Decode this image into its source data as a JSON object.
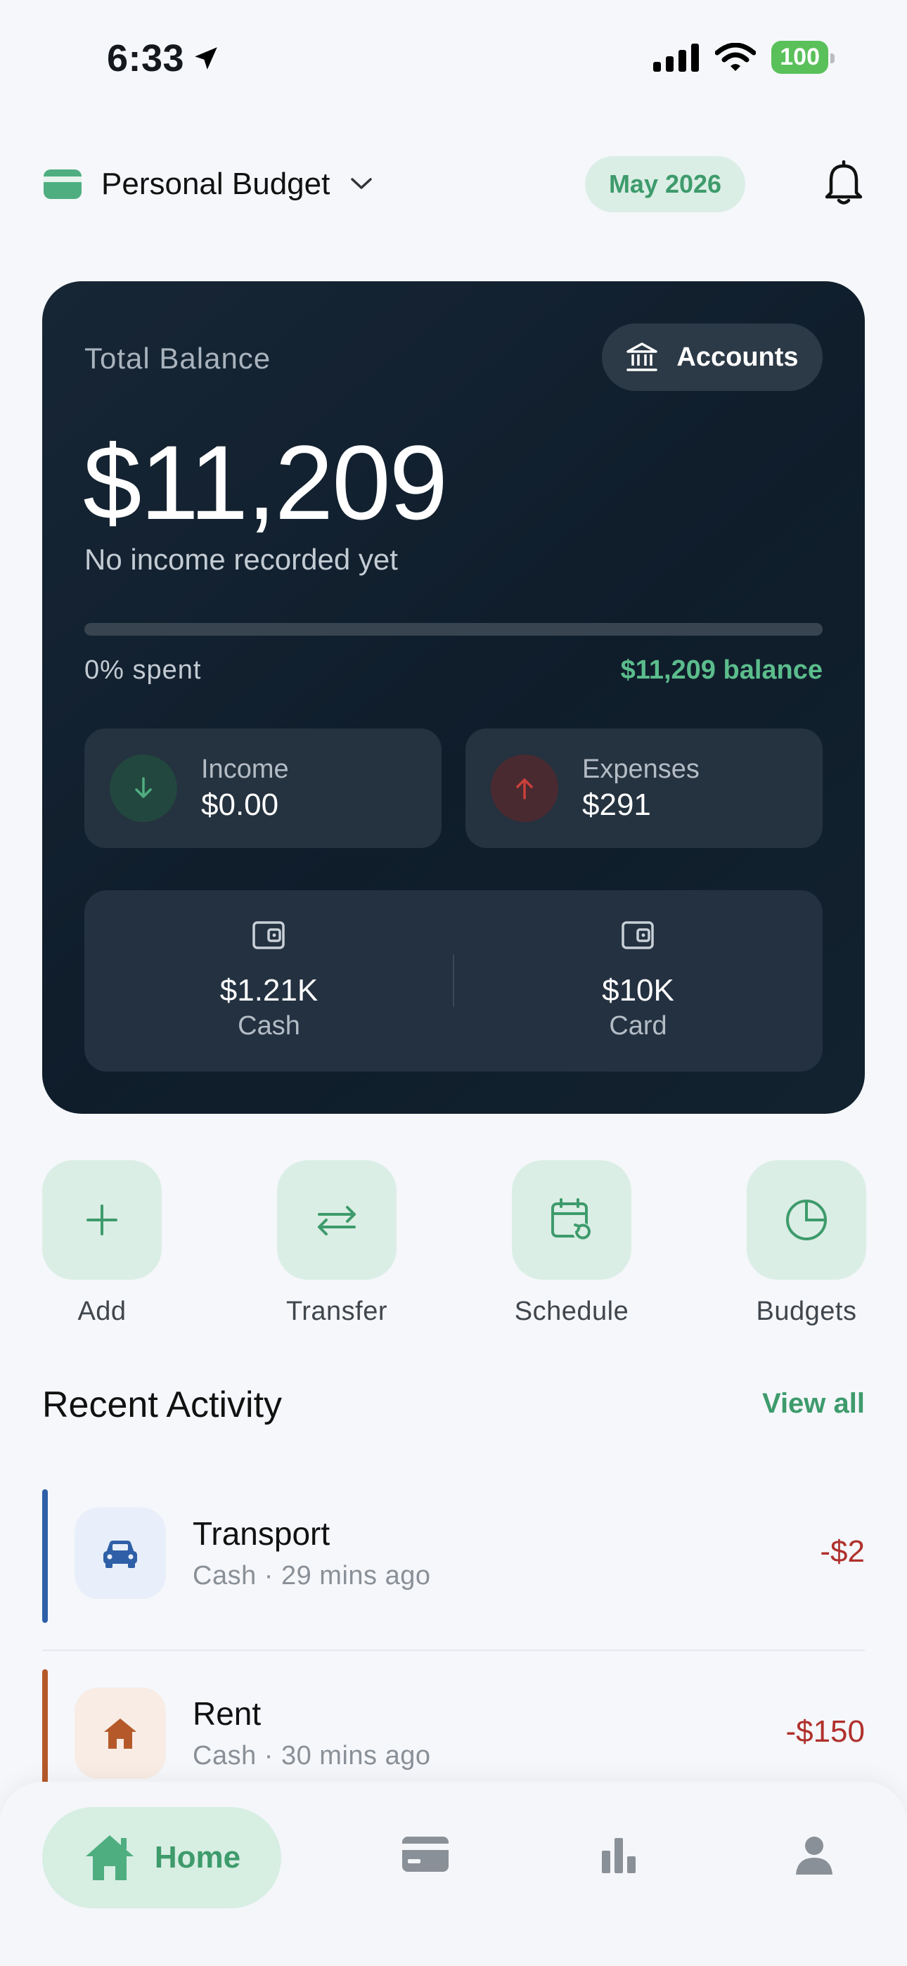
{
  "status_bar": {
    "time": "6:33",
    "battery": "100"
  },
  "header": {
    "budget_name": "Personal Budget",
    "month": "May 2026"
  },
  "balance_card": {
    "total_label": "Total Balance",
    "accounts_button": "Accounts",
    "total_balance": "$11,209",
    "income_note": "No income recorded yet",
    "spent_fraction": 0,
    "spent_label": "0% spent",
    "balance_label": "$11,209 balance",
    "income": {
      "label": "Income",
      "value": "$0.00"
    },
    "expenses": {
      "label": "Expenses",
      "value": "$291"
    },
    "accounts": [
      {
        "value": "$1.21K",
        "name": "Cash"
      },
      {
        "value": "$10K",
        "name": "Card"
      }
    ]
  },
  "quick_actions": [
    {
      "label": "Add",
      "icon": "plus-icon"
    },
    {
      "label": "Transfer",
      "icon": "transfer-arrows-icon"
    },
    {
      "label": "Schedule",
      "icon": "calendar-repeat-icon"
    },
    {
      "label": "Budgets",
      "icon": "pie-chart-icon"
    }
  ],
  "recent_activity": {
    "title": "Recent Activity",
    "view_all": "View all",
    "transactions": [
      {
        "name": "Transport",
        "meta": "Cash · 29 mins ago",
        "amount": "-$2",
        "color": "#2f5fa7",
        "icon": "car-icon"
      },
      {
        "name": "Rent",
        "meta": "Cash · 30 mins ago",
        "amount": "-$150",
        "color": "#b5592a",
        "icon": "home-icon"
      }
    ]
  },
  "bottom_nav": {
    "home_label": "Home"
  },
  "colors": {
    "accent": "#3e9b6c",
    "card_bg": "#0f1d2b",
    "negative": "#b0302c"
  }
}
